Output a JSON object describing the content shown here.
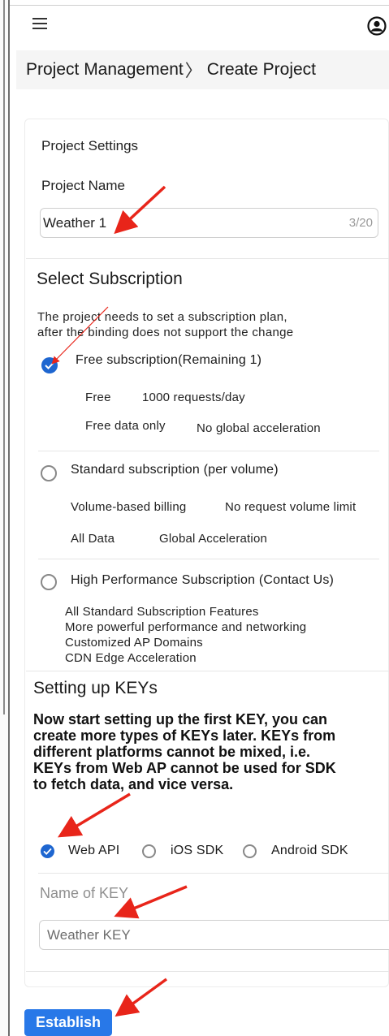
{
  "header": {
    "menu_icon": "hamburger-icon",
    "user_icon": "user-circle-icon",
    "breadcrumb": {
      "parent": "Project Management",
      "separator": "〉",
      "current": "Create Project"
    }
  },
  "project_settings": {
    "title": "Project Settings",
    "name_label": "Project Name",
    "name_value": "Weather 1",
    "name_counter": "3/20"
  },
  "subscription": {
    "title": "Select Subscription",
    "desc_line1": "The project needs to set a subscription plan,",
    "desc_line2": "after the binding does not support the change",
    "plans": [
      {
        "label": "Free subscription(Remaining 1)",
        "checked": true,
        "row1_a": "Free",
        "row1_b": "1000 requests/day",
        "row2_a": "Free data only",
        "row2_b": "No global acceleration"
      },
      {
        "label": "Standard subscription (per volume)",
        "checked": false,
        "row1_a": "Volume-based billing",
        "row1_b": "No request volume limit",
        "row2_a": "All Data",
        "row2_b": "Global Acceleration"
      },
      {
        "label": "High Performance Subscription (Contact Us)",
        "checked": false,
        "features": [
          "All Standard Subscription Features",
          "More powerful performance and networking",
          "Customized AP Domains",
          "CDN Edge Acceleration"
        ]
      }
    ]
  },
  "keys": {
    "title": "Setting up KEYs",
    "desc_lines": [
      "Now start setting up the first KEY, you can",
      "create more types of KEYs later. KEYs from",
      "different platforms cannot be mixed, i.e.",
      "KEYs from Web AP cannot be used for SDK",
      "to fetch data, and vice versa."
    ],
    "platforms": [
      {
        "label": "Web API",
        "checked": true
      },
      {
        "label": "iOS SDK",
        "checked": false
      },
      {
        "label": "Android SDK",
        "checked": false
      }
    ],
    "name_label": "Name of KEY",
    "name_value": "Weather KEY"
  },
  "actions": {
    "establish_label": "Establish"
  },
  "colors": {
    "accent": "#2878e8",
    "radio_checked": "#1e66d0",
    "annotation_arrow": "#e8251a"
  }
}
